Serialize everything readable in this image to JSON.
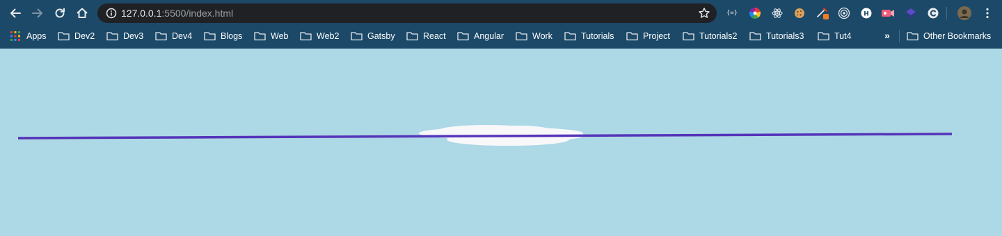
{
  "browser": {
    "url_host": "127.0.0.1",
    "url_path": ":5500/index.html",
    "bookmarks": [
      {
        "label": "Apps",
        "icon": "apps-grid-icon"
      },
      {
        "label": "Dev2",
        "icon": "folder-icon"
      },
      {
        "label": "Dev3",
        "icon": "folder-icon"
      },
      {
        "label": "Dev4",
        "icon": "folder-icon"
      },
      {
        "label": "Blogs",
        "icon": "folder-icon"
      },
      {
        "label": "Web",
        "icon": "folder-icon"
      },
      {
        "label": "Web2",
        "icon": "folder-icon"
      },
      {
        "label": "Gatsby",
        "icon": "folder-icon"
      },
      {
        "label": "React",
        "icon": "folder-icon"
      },
      {
        "label": "Angular",
        "icon": "folder-icon"
      },
      {
        "label": "Work",
        "icon": "folder-icon"
      },
      {
        "label": "Tutorials",
        "icon": "folder-icon"
      },
      {
        "label": "Project",
        "icon": "folder-icon"
      },
      {
        "label": "Tutorials2",
        "icon": "folder-icon"
      },
      {
        "label": "Tutorials3",
        "icon": "folder-icon"
      },
      {
        "label": "Tut4",
        "icon": "folder-icon"
      }
    ],
    "more_bookmarks": "»",
    "other_bookmarks": "Other Bookmarks"
  },
  "colors": {
    "toolbar": "#1c4968",
    "omnibox": "#202124",
    "sky": "#add8e6",
    "line": "#5534b9",
    "cloud": "#f8f8fa"
  }
}
